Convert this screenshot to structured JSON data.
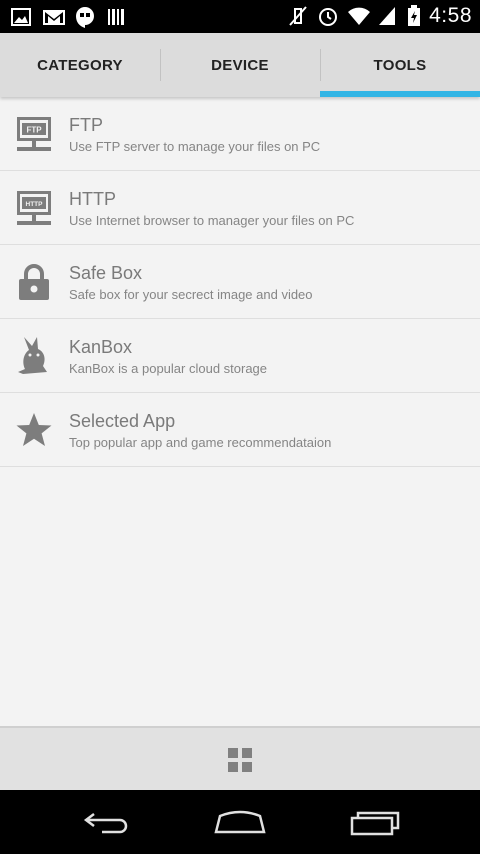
{
  "status_bar": {
    "time": "4:58",
    "icons_left": [
      "picture-icon",
      "gmail-icon",
      "hangouts-icon",
      "barcode-icon"
    ],
    "icons_right": [
      "mute-icon",
      "alarm-icon",
      "wifi-icon",
      "signal-icon",
      "battery-icon"
    ]
  },
  "tabs": [
    {
      "label": "CATEGORY",
      "active": false
    },
    {
      "label": "DEVICE",
      "active": false
    },
    {
      "label": "TOOLS",
      "active": true
    }
  ],
  "accent_color": "#33b5e5",
  "tools": [
    {
      "title": "FTP",
      "subtitle": "Use FTP server to manage your files on PC",
      "icon": "ftp-server-icon"
    },
    {
      "title": "HTTP",
      "subtitle": "Use Internet browser to manager your files on PC",
      "icon": "http-server-icon"
    },
    {
      "title": "Safe Box",
      "subtitle": "Safe box for your secrect image and video",
      "icon": "lock-icon"
    },
    {
      "title": "KanBox",
      "subtitle": "KanBox is a popular cloud storage",
      "icon": "rabbit-icon"
    },
    {
      "title": "Selected App",
      "subtitle": "Top popular app and game recommendataion",
      "icon": "star-icon"
    }
  ],
  "bottom_bar": {
    "icon": "grid-icon"
  },
  "nav_bar": {
    "icons": [
      "back-icon",
      "home-icon",
      "recent-apps-icon"
    ]
  }
}
